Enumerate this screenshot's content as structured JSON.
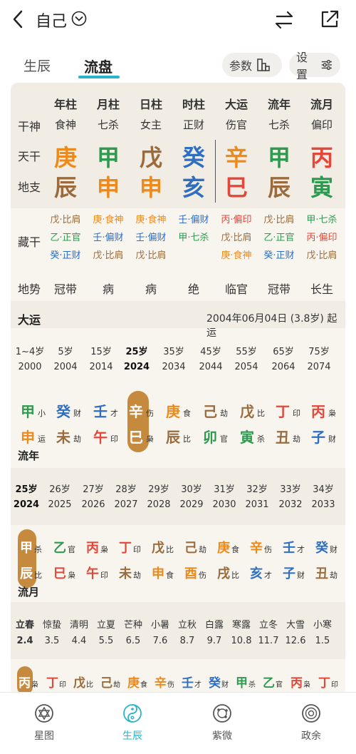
{
  "header": {
    "title": "自己"
  },
  "tabs": [
    {
      "label": "生辰"
    },
    {
      "label": "流盘"
    }
  ],
  "buttons": {
    "params": "参数",
    "settings": "设置"
  },
  "chart": {
    "columns": [
      "年柱",
      "月柱",
      "日柱",
      "时柱",
      "大运",
      "流年",
      "流月"
    ],
    "row_labels": {
      "shishen": "干神",
      "tiangan": "天干",
      "dizhi": "地支",
      "canggan": "藏干",
      "dishi": "地势"
    },
    "shishen": [
      "食神",
      "七杀",
      "女主",
      "正财",
      "伤官",
      "七杀",
      "偏印"
    ],
    "tiangan": [
      "庚",
      "甲",
      "戊",
      "癸",
      "辛",
      "甲",
      "丙"
    ],
    "dizhi": [
      "辰",
      "申",
      "申",
      "亥",
      "巳",
      "辰",
      "寅"
    ],
    "canggan": [
      [
        "戊·比肩",
        "乙·正官",
        "癸·正财"
      ],
      [
        "庚·食神",
        "壬·偏财",
        "戊·比肩"
      ],
      [
        "庚·食神",
        "壬·偏财",
        "戊·比肩"
      ],
      [
        "壬·偏财",
        "甲·七杀"
      ],
      [
        "丙·偏印",
        "戊·比肩",
        "庚·食神"
      ],
      [
        "戊·比肩",
        "乙·正官",
        "癸·正财"
      ],
      [
        "甲·七杀",
        "丙·偏印",
        "戊·比肩"
      ]
    ],
    "dishi": [
      "冠带",
      "病",
      "病",
      "绝",
      "临官",
      "冠带",
      "长生"
    ]
  },
  "dayun": {
    "title": "大运",
    "start_text": "2004年06月04日 (3.8岁) 起运",
    "ages": [
      "1~4岁",
      "5岁",
      "15岁",
      "25岁",
      "35岁",
      "45岁",
      "55岁",
      "65岁",
      "75岁"
    ],
    "years": [
      "2000",
      "2004",
      "2014",
      "2024",
      "2034",
      "2044",
      "2054",
      "2064",
      "2074"
    ],
    "gan": [
      {
        "c": "甲",
        "t": "小"
      },
      {
        "c": "癸",
        "t": "财"
      },
      {
        "c": "壬",
        "t": "才"
      },
      {
        "c": "辛",
        "t": "伤"
      },
      {
        "c": "庚",
        "t": "食"
      },
      {
        "c": "己",
        "t": "劫"
      },
      {
        "c": "戊",
        "t": "比"
      },
      {
        "c": "丁",
        "t": "印"
      },
      {
        "c": "丙",
        "t": "枭"
      }
    ],
    "zhi": [
      {
        "c": "申",
        "t": "运"
      },
      {
        "c": "未",
        "t": "劫"
      },
      {
        "c": "午",
        "t": "印"
      },
      {
        "c": "巳",
        "t": "枭"
      },
      {
        "c": "辰",
        "t": "比"
      },
      {
        "c": "卯",
        "t": "官"
      },
      {
        "c": "寅",
        "t": "杀"
      },
      {
        "c": "丑",
        "t": "劫"
      },
      {
        "c": "子",
        "t": "财"
      }
    ]
  },
  "liunian": {
    "label": "流年",
    "ages": [
      "25岁",
      "26岁",
      "27岁",
      "28岁",
      "29岁",
      "30岁",
      "31岁",
      "32岁",
      "33岁",
      "34岁"
    ],
    "years": [
      "2024",
      "2025",
      "2026",
      "2027",
      "2028",
      "2029",
      "2030",
      "2031",
      "2032",
      "2033"
    ],
    "gan": [
      {
        "c": "甲",
        "t": "杀"
      },
      {
        "c": "乙",
        "t": "官"
      },
      {
        "c": "丙",
        "t": "枭"
      },
      {
        "c": "丁",
        "t": "印"
      },
      {
        "c": "戊",
        "t": "比"
      },
      {
        "c": "己",
        "t": "劫"
      },
      {
        "c": "庚",
        "t": "食"
      },
      {
        "c": "辛",
        "t": "伤"
      },
      {
        "c": "壬",
        "t": "才"
      },
      {
        "c": "癸",
        "t": "财"
      }
    ],
    "zhi": [
      {
        "c": "辰",
        "t": "比"
      },
      {
        "c": "巳",
        "t": "枭"
      },
      {
        "c": "午",
        "t": "印"
      },
      {
        "c": "未",
        "t": "劫"
      },
      {
        "c": "申",
        "t": "食"
      },
      {
        "c": "酉",
        "t": "伤"
      },
      {
        "c": "戌",
        "t": "比"
      },
      {
        "c": "亥",
        "t": "才"
      },
      {
        "c": "子",
        "t": "财"
      },
      {
        "c": "丑",
        "t": "劫"
      }
    ]
  },
  "liuyue": {
    "label": "流月",
    "jieqi": [
      "立春",
      "惊蛰",
      "清明",
      "立夏",
      "芒种",
      "小暑",
      "立秋",
      "白露",
      "寒露",
      "立冬",
      "大雪",
      "小寒"
    ],
    "dates": [
      "2.4",
      "3.5",
      "4.4",
      "5.5",
      "6.5",
      "7.6",
      "8.7",
      "9.7",
      "10.8",
      "11.7",
      "12.6",
      "1.5"
    ],
    "gan": [
      {
        "c": "丙",
        "t": "枭"
      },
      {
        "c": "丁",
        "t": "印"
      },
      {
        "c": "戊",
        "t": "比"
      },
      {
        "c": "己",
        "t": "劫"
      },
      {
        "c": "庚",
        "t": "食"
      },
      {
        "c": "辛",
        "t": "伤"
      },
      {
        "c": "壬",
        "t": "才"
      },
      {
        "c": "癸",
        "t": "财"
      },
      {
        "c": "甲",
        "t": "杀"
      },
      {
        "c": "乙",
        "t": "官"
      },
      {
        "c": "丙",
        "t": "枭"
      },
      {
        "c": "丁",
        "t": "印"
      }
    ]
  },
  "bottom_nav": [
    {
      "label": "星图",
      "icon": "star-of-david-icon"
    },
    {
      "label": "生辰",
      "icon": "yin-yang-icon"
    },
    {
      "label": "紫微",
      "icon": "orbit-icon"
    },
    {
      "label": "政余",
      "icon": "compass-icon"
    }
  ]
}
